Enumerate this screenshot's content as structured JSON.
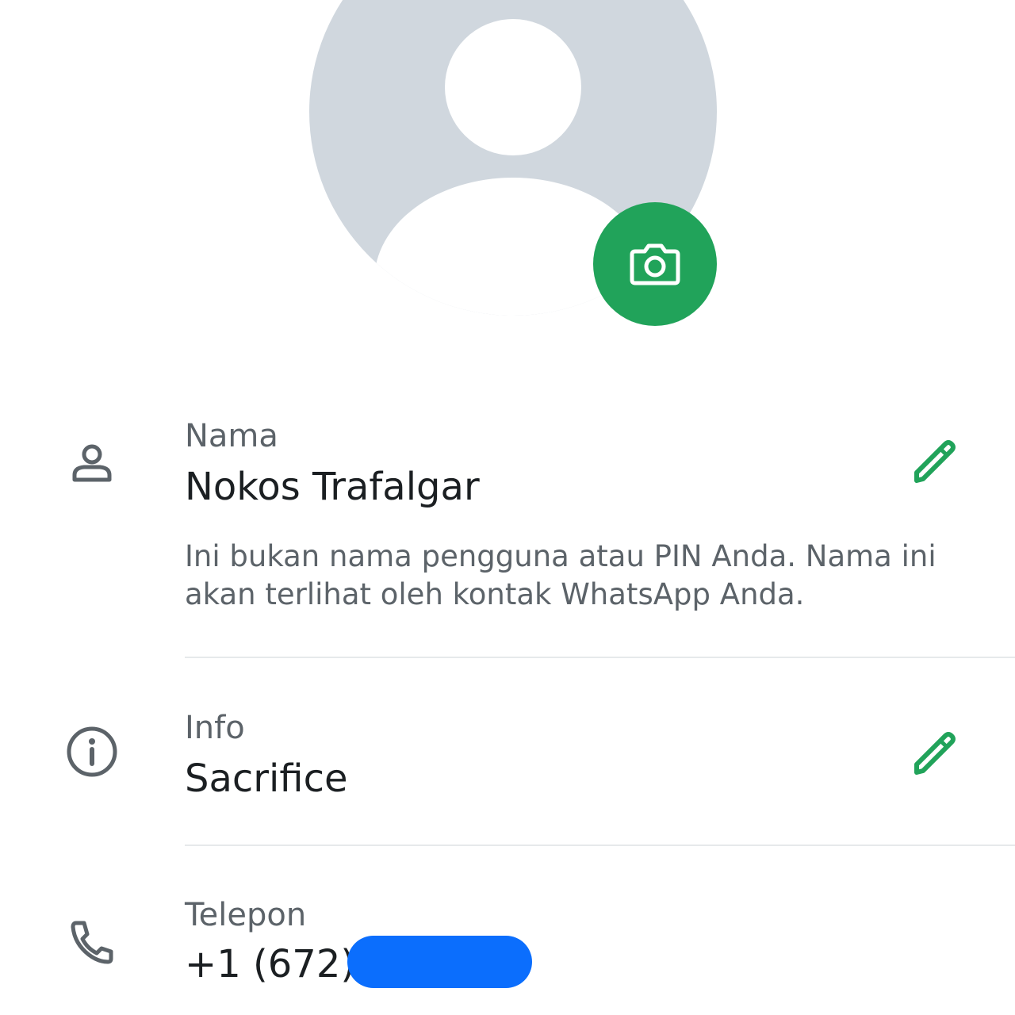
{
  "colors": {
    "accent": "#21a35a",
    "avatar_bg": "#d0d7de",
    "redaction": "#0b6efd",
    "icon_gray": "#5c6369"
  },
  "avatar": {
    "icon": "default-person-avatar",
    "camera_icon": "camera-icon"
  },
  "name_row": {
    "icon": "person-icon",
    "label": "Nama",
    "value": "Nokos Trafalgar",
    "helper": "Ini bukan nama pengguna atau PIN Anda. Nama ini akan terlihat oleh kontak WhatsApp Anda.",
    "edit_icon": "pencil-icon"
  },
  "info_row": {
    "icon": "info-icon",
    "label": "Info",
    "value": "Sacrifice",
    "edit_icon": "pencil-icon"
  },
  "phone_row": {
    "icon": "phone-icon",
    "label": "Telepon",
    "value": "+1 (672)"
  }
}
